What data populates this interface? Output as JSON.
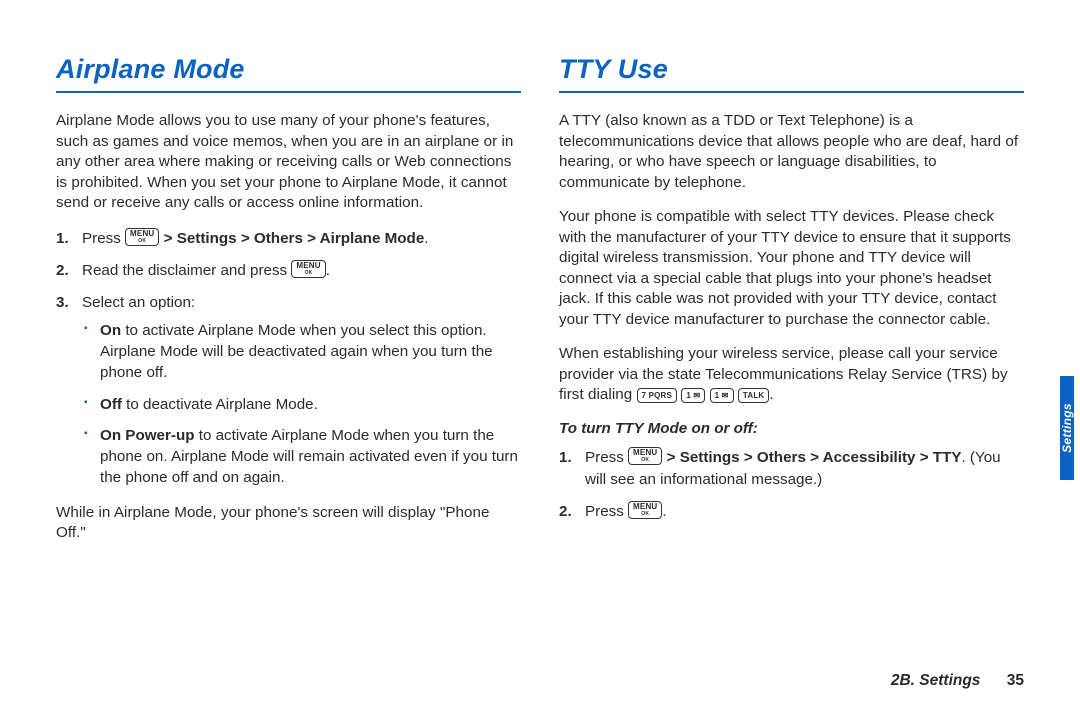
{
  "left": {
    "heading": "Airplane Mode",
    "intro": "Airplane Mode allows you to use many of your phone's features, such as games and voice memos, when you are in an airplane or in any other area where making or receiving calls or Web connections is prohibited. When you set your phone to Airplane Mode, it cannot send or receive any calls or access online information.",
    "steps": {
      "s1_a": "Press ",
      "s1_b": " > Settings > Others > Airplane Mode",
      "s2_a": "Read the disclaimer and press ",
      "s3": "Select an option:",
      "opt1_b": "On",
      "opt1_t": " to activate Airplane Mode when you select this option. Airplane Mode will be deactivated again when you turn the phone off.",
      "opt2_b": "Off",
      "opt2_t": " to deactivate Airplane Mode.",
      "opt3_b": "On Power-up",
      "opt3_t": " to activate Airplane Mode when you turn the phone on. Airplane Mode will remain activated even if you turn the phone off and on again."
    },
    "outro": "While in Airplane Mode, your phone's screen will display \"Phone Off.\""
  },
  "right": {
    "heading": "TTY Use",
    "p1": "A TTY (also known as a TDD or Text Telephone) is a telecommunications device that allows people who are deaf, hard of hearing, or who have speech or language disabilities, to communicate by telephone.",
    "p2": "Your phone is compatible with select TTY devices. Please check with the manufacturer of your TTY device to ensure that it supports digital wireless transmission. Your phone and TTY device will connect via a special cable that plugs into your phone's headset jack. If this cable was not provided with your TTY device, contact your TTY device manufacturer to purchase the connector cable.",
    "p3_a": "When establishing your wireless service, please call your service provider via the state Telecommunications Relay Service (TRS) by first dialing ",
    "sub_h": "To turn TTY Mode on or off:",
    "steps": {
      "s1_a": "Press ",
      "s1_b": " > Settings > Others > Accessibility > TTY",
      "s1_c": ". (You will see an informational message.)",
      "s2_a": "Press "
    }
  },
  "keys": {
    "menu_top": "MENU",
    "menu_bot": "OK",
    "k7": "7 PQRS",
    "k1": "1 ✉",
    "talk": "TALK"
  },
  "tab": "Settings",
  "footer_section": "2B. Settings",
  "footer_page": "35"
}
